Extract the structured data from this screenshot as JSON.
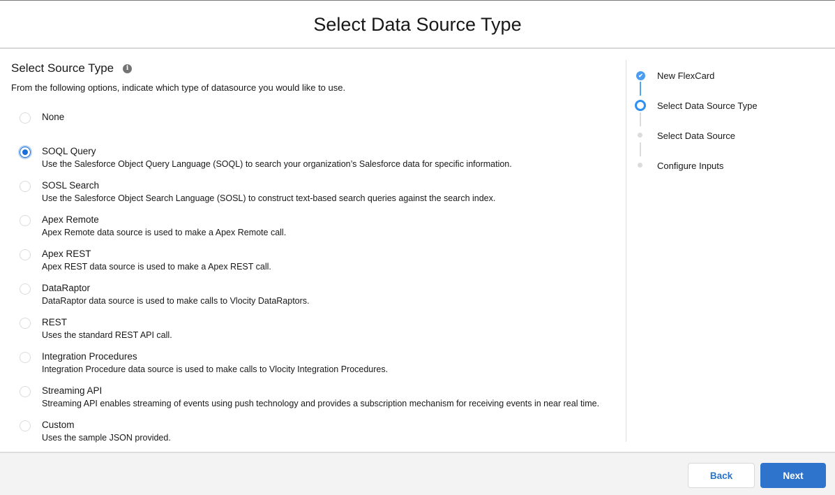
{
  "header": {
    "title": "Select Data Source Type"
  },
  "main": {
    "section_title": "Select Source Type",
    "info_icon": "info-icon",
    "description": "From the following options, indicate which type of datasource you would like to use.",
    "selected_option": "SOQL Query",
    "options": [
      {
        "label": "None",
        "description": "",
        "checked": false
      },
      {
        "label": "SOQL Query",
        "description": "Use the Salesforce Object Query Language (SOQL) to search your organization’s Salesforce data for specific information.",
        "checked": true
      },
      {
        "label": "SOSL Search",
        "description": "Use the Salesforce Object Search Language (SOSL) to construct text-based search queries against the search index.",
        "checked": false
      },
      {
        "label": "Apex Remote",
        "description": "Apex Remote data source is used to make a Apex Remote call.",
        "checked": false
      },
      {
        "label": "Apex REST",
        "description": "Apex REST data source is used to make a Apex REST call.",
        "checked": false
      },
      {
        "label": "DataRaptor",
        "description": "DataRaptor data source is used to make calls to Vlocity DataRaptors.",
        "checked": false
      },
      {
        "label": "REST",
        "description": "Uses the standard REST API call.",
        "checked": false
      },
      {
        "label": "Integration Procedures",
        "description": "Integration Procedure data source is used to make calls to Vlocity Integration Procedures.",
        "checked": false
      },
      {
        "label": "Streaming API",
        "description": "Streaming API enables streaming of events using push technology and provides a subscription mechanism for receiving events in near real time.",
        "checked": false
      },
      {
        "label": "Custom",
        "description": "Uses the sample JSON provided.",
        "checked": false
      }
    ]
  },
  "steps": [
    {
      "label": "New FlexCard",
      "status": "completed"
    },
    {
      "label": "Select Data Source Type",
      "status": "current"
    },
    {
      "label": "Select Data Source",
      "status": "pending"
    },
    {
      "label": "Configure Inputs",
      "status": "pending"
    }
  ],
  "footer": {
    "back_label": "Back",
    "next_label": "Next"
  },
  "colors": {
    "accent": "#2f74cc",
    "step_complete": "#4a9df0",
    "step_current": "#2f8ff2",
    "radio_checked": "#1b6ddc"
  }
}
